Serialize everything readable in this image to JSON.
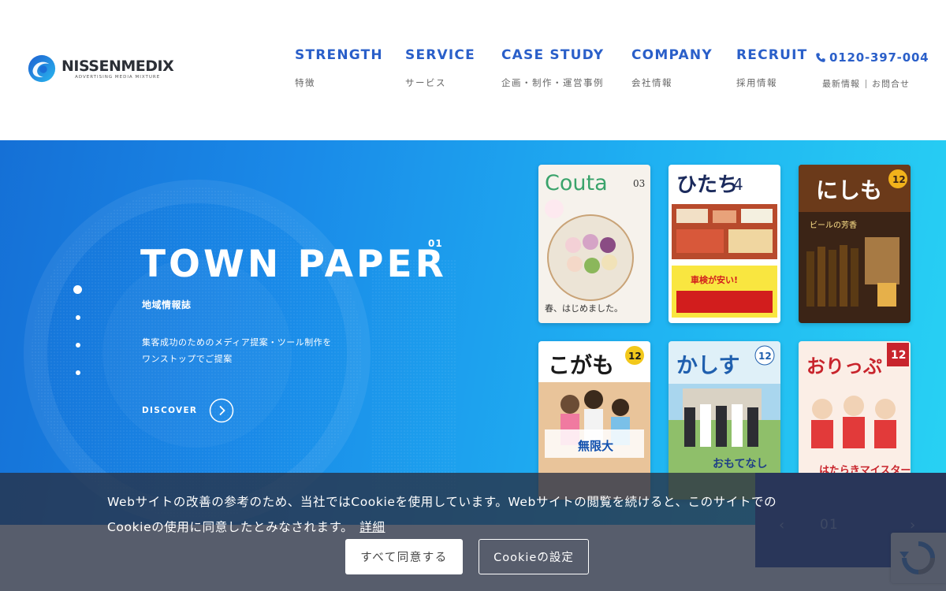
{
  "logo": {
    "name": "NISSENMEDIX",
    "tagline": "ADVERTISING MEDIA MIXTURE"
  },
  "nav": [
    {
      "en": "STRENGTH",
      "ja": "特徴"
    },
    {
      "en": "SERVICE",
      "ja": "サービス"
    },
    {
      "en": "CASE STUDY",
      "ja": "企画・制作・運営事例"
    },
    {
      "en": "COMPANY",
      "ja": "会社情報"
    },
    {
      "en": "RECRUIT",
      "ja": "採用情報"
    }
  ],
  "phone": "0120-397-004",
  "sub_links": [
    "最新情報",
    "お問合せ"
  ],
  "hero": {
    "title": "TOWN PAPER",
    "number": "01",
    "subtitle": "地域情報誌",
    "description": [
      "集客成功のためのメディア提案・ツール制作を",
      "ワンストップでご提案"
    ],
    "cta": "DISCOVER",
    "slide_count": 4,
    "active_slide": 1
  },
  "magazines": [
    {
      "title": "Couta",
      "issue": "03",
      "caption": "春、はじめました。"
    },
    {
      "title": "ひたち",
      "issue": "4",
      "caption": "車検が安い!"
    },
    {
      "title": "にしも",
      "issue": "12",
      "caption": "ビールの芳香"
    },
    {
      "title": "こがも",
      "issue": "12",
      "caption": "無限大"
    },
    {
      "title": "かしす",
      "issue": "12",
      "caption": "おもてなし"
    },
    {
      "title": "おりっぷ",
      "issue": "12",
      "caption": "はたらきマイスター"
    }
  ],
  "pager": {
    "current": "01",
    "prev": "‹",
    "next": "›"
  },
  "cookie": {
    "message": "Webサイトの改善の参考のため、当社ではCookieを使用しています。Webサイトの閲覧を続けると、このサイトでのCookieの使用に同意したとみなされます。",
    "details_link": "詳細",
    "accept_label": "すべて同意する",
    "settings_label": "Cookieの設定"
  },
  "colors": {
    "brand": "#2a5fc9",
    "hero_start": "#1570d6",
    "hero_end": "#28d2f3",
    "pager_bg": "#2d4eaa"
  }
}
